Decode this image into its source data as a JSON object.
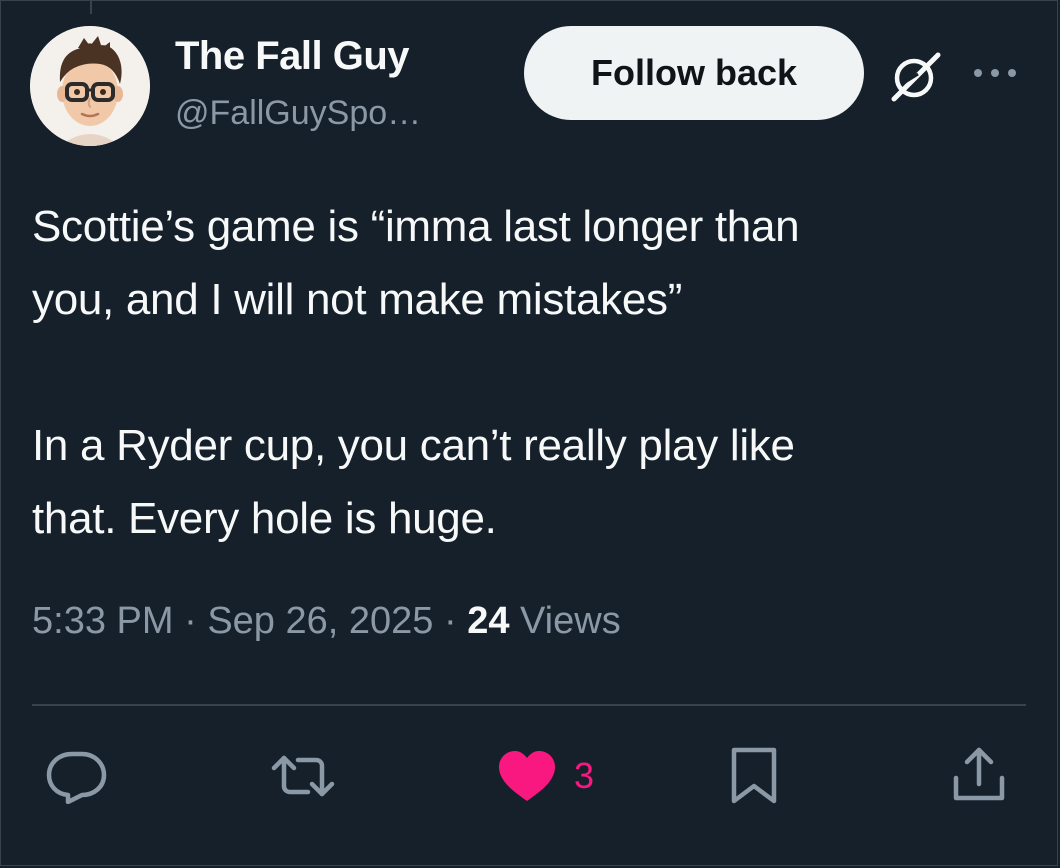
{
  "author": {
    "display_name": "The Fall Guy",
    "handle": "@FallGuySpo…",
    "follow_label": "Follow back"
  },
  "tweet": {
    "paragraph1_line1": "Scottie’s game is “imma last longer than",
    "paragraph1_line2": "you, and I will not make mistakes”",
    "paragraph2_line1": "In a Ryder cup, you can’t really play like",
    "paragraph2_line2": "that. Every hole is huge."
  },
  "meta": {
    "time": "5:33 PM",
    "separator": " · ",
    "date": "Sep 26, 2025",
    "views_count": "24",
    "views_label": " Views"
  },
  "actions": {
    "like_count": "3"
  },
  "icons": {
    "reply": "reply-icon",
    "retweet": "retweet-icon",
    "like": "heart-icon",
    "bookmark": "bookmark-icon",
    "share": "share-icon",
    "grok": "grok-icon",
    "more": "more-icon"
  },
  "colors": {
    "background": "#15202b",
    "text": "#f7f9f9",
    "secondary_text": "#8b98a5",
    "like": "#f91880",
    "button_bg": "#eff3f4"
  }
}
